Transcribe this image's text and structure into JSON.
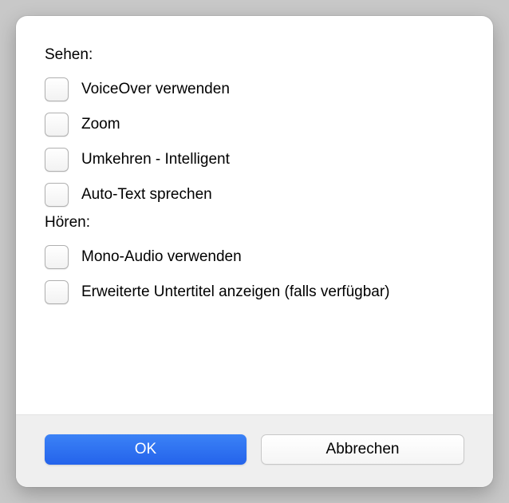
{
  "sections": {
    "seeing": {
      "label": "Sehen:",
      "items": [
        {
          "label": "VoiceOver verwenden"
        },
        {
          "label": "Zoom"
        },
        {
          "label": "Umkehren - Intelligent"
        },
        {
          "label": "Auto-Text sprechen"
        }
      ]
    },
    "hearing": {
      "label": "Hören:",
      "items": [
        {
          "label": "Mono-Audio verwenden"
        },
        {
          "label": "Erweiterte Untertitel anzeigen (falls verfügbar)"
        }
      ]
    }
  },
  "buttons": {
    "ok": "OK",
    "cancel": "Abbrechen"
  }
}
